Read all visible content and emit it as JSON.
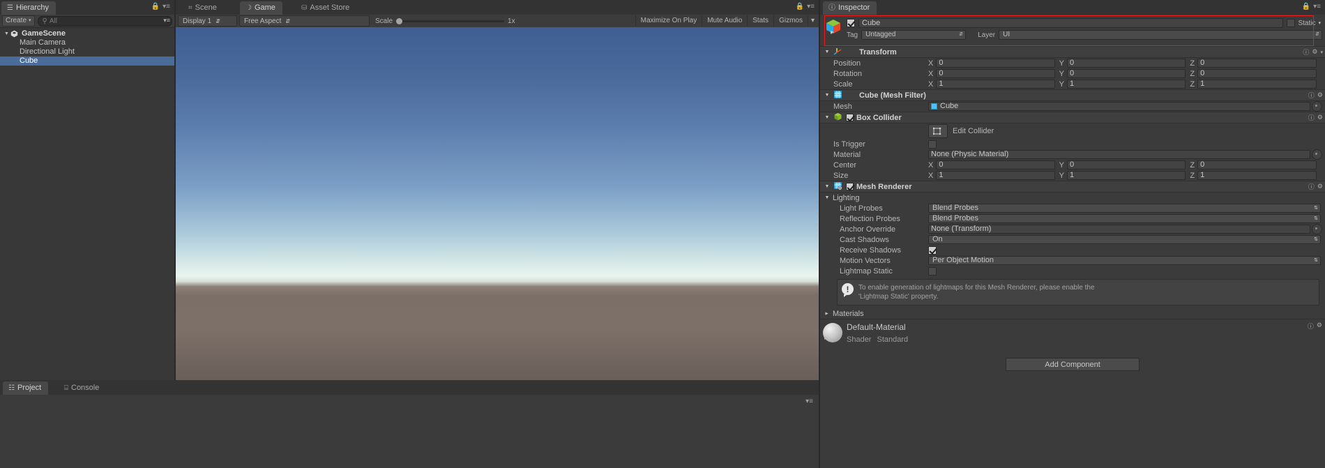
{
  "hierarchy": {
    "tab_label": "Hierarchy",
    "tab_icon": "hierarchy-icon",
    "create_label": "Create",
    "search_placeholder": "All",
    "items": [
      {
        "label": "GameScene",
        "depth": 0,
        "expanded": true,
        "selected": false,
        "is_scene": true
      },
      {
        "label": "Main Camera",
        "depth": 1,
        "expanded": false,
        "selected": false,
        "is_scene": false
      },
      {
        "label": "Directional Light",
        "depth": 1,
        "expanded": false,
        "selected": false,
        "is_scene": false
      },
      {
        "label": "Cube",
        "depth": 1,
        "expanded": false,
        "selected": true,
        "is_scene": false
      }
    ]
  },
  "gameview": {
    "tabs": [
      {
        "label": "Scene",
        "icon": "grid-icon",
        "active": false
      },
      {
        "label": "Game",
        "icon": "gamepad-icon",
        "active": true
      },
      {
        "label": "Asset Store",
        "icon": "store-icon",
        "active": false
      }
    ],
    "display": "Display 1",
    "aspect": "Free Aspect",
    "scale_label": "Scale",
    "scale_value": "1x",
    "right_buttons": [
      "Maximize On Play",
      "Mute Audio",
      "Stats",
      "Gizmos"
    ]
  },
  "inspector": {
    "tab_label": "Inspector",
    "tab_icon": "info-icon",
    "object": {
      "name": "Cube",
      "enabled": true,
      "static_label": "Static",
      "static_checked": false,
      "tag_label": "Tag",
      "tag_value": "Untagged",
      "layer_label": "Layer",
      "layer_value": "UI"
    },
    "transform": {
      "title": "Transform",
      "rows": [
        {
          "label": "Position",
          "x": "0",
          "y": "0",
          "z": "0"
        },
        {
          "label": "Rotation",
          "x": "0",
          "y": "0",
          "z": "0"
        },
        {
          "label": "Scale",
          "x": "1",
          "y": "1",
          "z": "1"
        }
      ]
    },
    "mesh_filter": {
      "title": "Cube (Mesh Filter)",
      "mesh_label": "Mesh",
      "mesh_value": "Cube"
    },
    "box_collider": {
      "title": "Box Collider",
      "enabled": true,
      "edit_collider_label": "Edit Collider",
      "is_trigger_label": "Is Trigger",
      "is_trigger_checked": false,
      "material_label": "Material",
      "material_value": "None (Physic Material)",
      "center": {
        "label": "Center",
        "x": "0",
        "y": "0",
        "z": "0"
      },
      "size": {
        "label": "Size",
        "x": "1",
        "y": "1",
        "z": "1"
      }
    },
    "mesh_renderer": {
      "title": "Mesh Renderer",
      "enabled": true,
      "lighting_label": "Lighting",
      "rows": [
        {
          "label": "Light Probes",
          "value": "Blend Probes",
          "type": "popup"
        },
        {
          "label": "Reflection Probes",
          "value": "Blend Probes",
          "type": "popup"
        },
        {
          "label": "Anchor Override",
          "value": "None (Transform)",
          "type": "object"
        },
        {
          "label": "Cast Shadows",
          "value": "On",
          "type": "popup"
        },
        {
          "label": "Receive Shadows",
          "value": "",
          "type": "checkbox",
          "checked": true
        },
        {
          "label": "Motion Vectors",
          "value": "Per Object Motion",
          "type": "popup"
        },
        {
          "label": "Lightmap Static",
          "value": "",
          "type": "checkbox",
          "checked": false
        }
      ],
      "info_line1": "To enable generation of lightmaps for this Mesh Renderer, please enable the",
      "info_line2": "'Lightmap Static' property.",
      "materials_label": "Materials"
    },
    "material": {
      "name": "Default-Material",
      "shader_label": "Shader",
      "shader_value": "Standard"
    },
    "add_component_label": "Add Component"
  },
  "bottom_dock": {
    "tabs": [
      {
        "label": "Project",
        "icon": "folder-icon",
        "active": true
      },
      {
        "label": "Console",
        "icon": "console-icon",
        "active": false
      }
    ]
  },
  "colors": {
    "selection_blue": "#4a6c9b",
    "highlight_red": "#ee1c1c",
    "panel_bg": "#383838",
    "tab_bg": "#333333"
  }
}
